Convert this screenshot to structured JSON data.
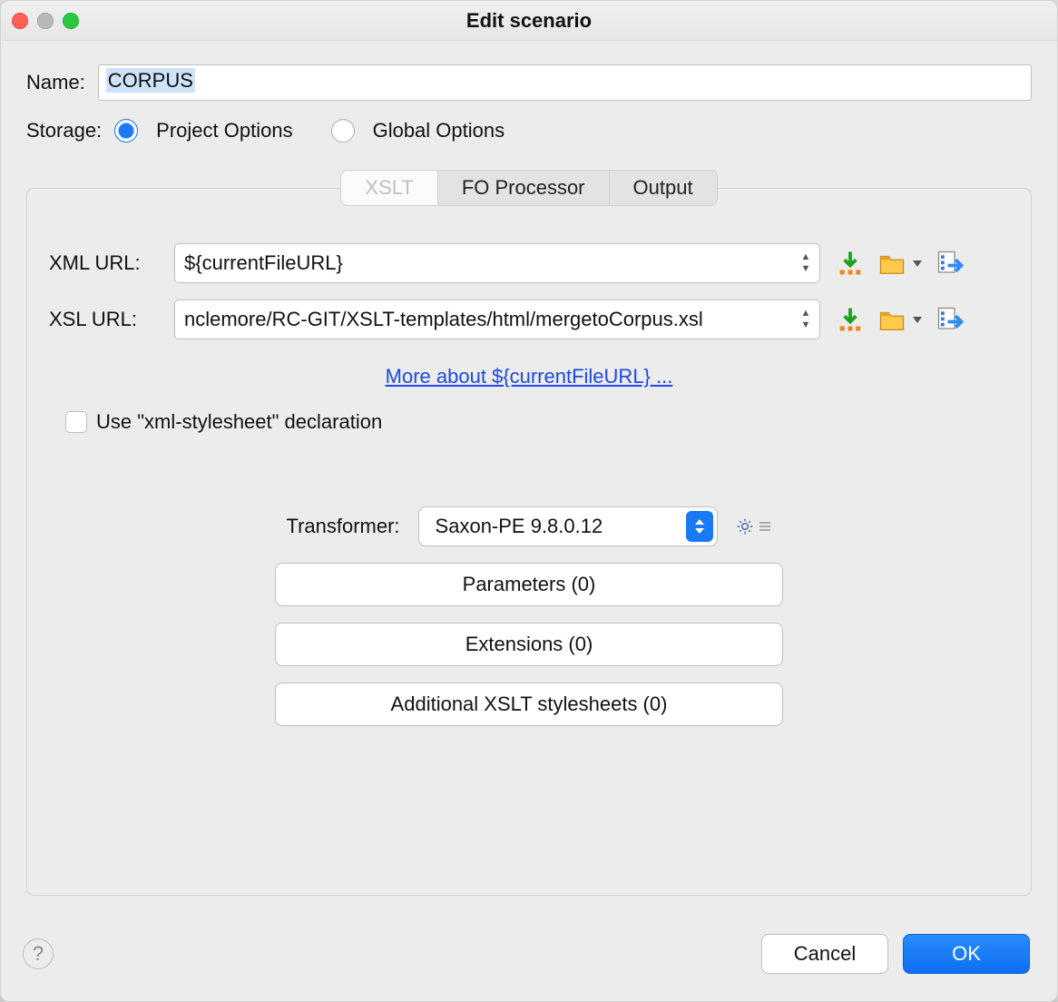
{
  "titlebar": {
    "title": "Edit scenario"
  },
  "form": {
    "name_label": "Name:",
    "name_value": "CORPUS",
    "storage_label": "Storage:",
    "storage_options": {
      "project": "Project Options",
      "global": "Global Options"
    }
  },
  "tabs": {
    "xslt": "XSLT",
    "fo": "FO Processor",
    "output": "Output"
  },
  "xslt_tab": {
    "xml_url_label": "XML URL:",
    "xml_url_value": "${currentFileURL}",
    "xsl_url_label": "XSL URL:",
    "xsl_url_value": "nclemore/RC-GIT/XSLT-templates/html/mergetoCorpus.xsl",
    "more_link": "More about ${currentFileURL} ...",
    "use_xml_stylesheet": "Use \"xml-stylesheet\" declaration",
    "transformer_label": "Transformer:",
    "transformer_value": "Saxon-PE 9.8.0.12",
    "parameters_btn": "Parameters (0)",
    "extensions_btn": "Extensions (0)",
    "additional_btn": "Additional XSLT stylesheets (0)"
  },
  "footer": {
    "cancel": "Cancel",
    "ok": "OK"
  },
  "icons": {
    "insert_variable": "insert-variable",
    "browse_folder": "browse-folder",
    "open_in_editor": "open-in-editor"
  }
}
